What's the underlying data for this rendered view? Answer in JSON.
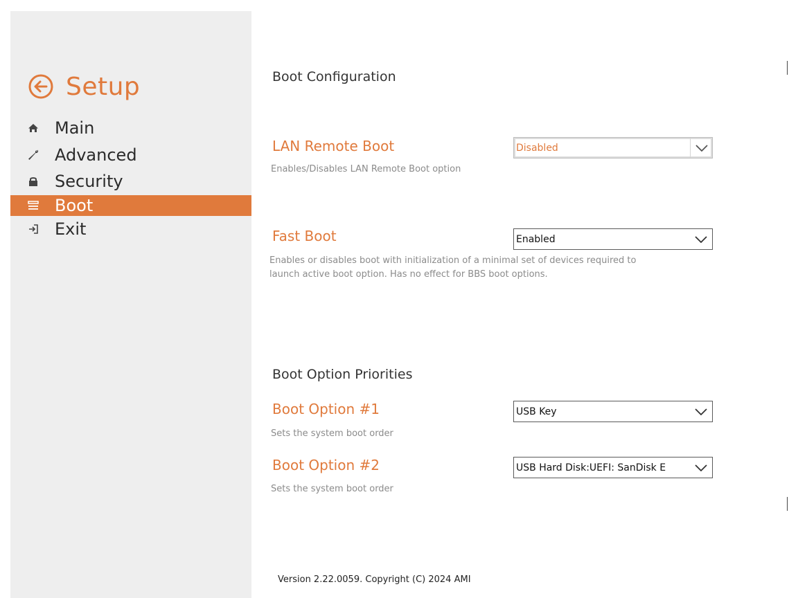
{
  "sidebar": {
    "title": "Setup",
    "items": [
      {
        "label": "Main",
        "icon": "home-icon",
        "active": false
      },
      {
        "label": "Advanced",
        "icon": "wrench-icon",
        "active": false
      },
      {
        "label": "Security",
        "icon": "lock-icon",
        "active": false
      },
      {
        "label": "Boot",
        "icon": "boot-list-icon",
        "active": true
      },
      {
        "label": "Exit",
        "icon": "exit-icon",
        "active": false
      }
    ]
  },
  "main": {
    "section_boot_config": "Boot Configuration",
    "lan_remote_boot": {
      "label": "LAN Remote Boot",
      "value": "Disabled",
      "help": "Enables/Disables LAN Remote Boot option"
    },
    "fast_boot": {
      "label": "Fast Boot",
      "value": "Enabled",
      "help_line1": "Enables or disables boot with initialization of a minimal set of devices required to",
      "help_line2": "launch active boot option. Has no effect for BBS boot options."
    },
    "section_priorities": "Boot Option Priorities",
    "boot_option_1": {
      "label": "Boot Option #1",
      "value": "USB Key",
      "help": "Sets the system boot order"
    },
    "boot_option_2": {
      "label": "Boot Option #2",
      "value": "USB Hard Disk:UEFI: SanDisk E",
      "help": "Sets the system boot order"
    }
  },
  "footer": {
    "version": "Version 2.22.0059. Copyright (C) 2024 AMI"
  },
  "colors": {
    "accent": "#e07a3c",
    "sidebar_bg": "#eeeeee",
    "text": "#2b2b2b",
    "help_text": "#8b8b8b"
  }
}
